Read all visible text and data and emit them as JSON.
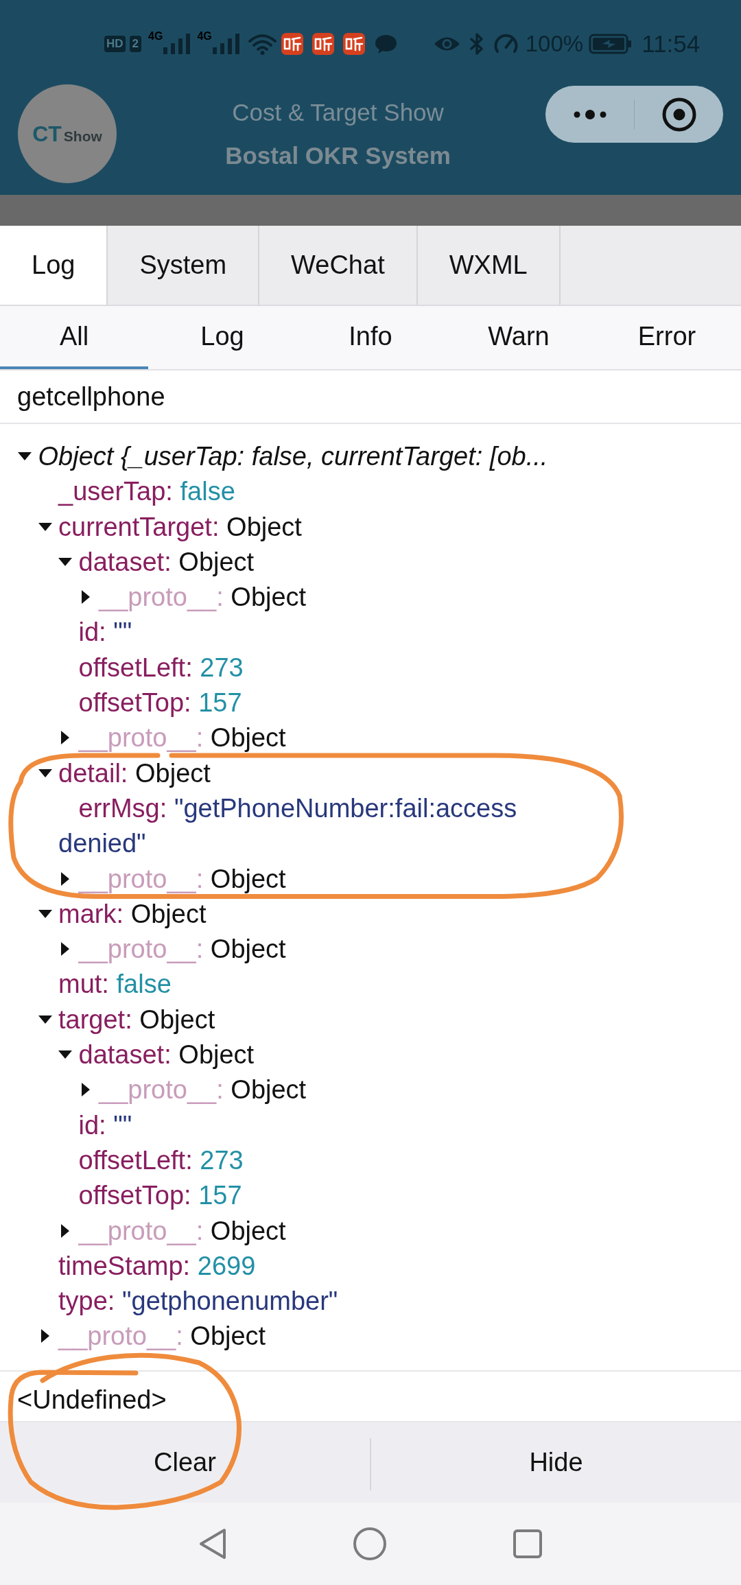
{
  "status_bar": {
    "hd_badge": "HD",
    "sim_badge": "2",
    "network_types": [
      "4G",
      "4G"
    ],
    "battery": "100%",
    "time": "11:54"
  },
  "header": {
    "logo": {
      "text": "CT",
      "subtext": "Show"
    },
    "title": "Cost & Target Show",
    "subtitle": "Bostal OKR System"
  },
  "tabs": [
    {
      "label": "Log",
      "selected": true
    },
    {
      "label": "System",
      "selected": false
    },
    {
      "label": "WeChat",
      "selected": false
    },
    {
      "label": "WXML",
      "selected": false
    }
  ],
  "filters": [
    {
      "label": "All",
      "selected": true
    },
    {
      "label": "Log",
      "selected": false
    },
    {
      "label": "Info",
      "selected": false
    },
    {
      "label": "Warn",
      "selected": false
    },
    {
      "label": "Error",
      "selected": false
    }
  ],
  "log_entries": [
    {
      "kind": "text",
      "text": "getcellphone"
    },
    {
      "kind": "object",
      "tree": [
        {
          "kind": "summary",
          "label": "Object {_userTap: false, currentTarget: [ob...",
          "expanded": true,
          "children": [
            {
              "kind": "boolean",
              "key": "_userTap:",
              "value": "false"
            },
            {
              "kind": "object",
              "key": "currentTarget:",
              "value": "Object",
              "expanded": true,
              "children": [
                {
                  "kind": "object",
                  "key": "dataset:",
                  "value": "Object",
                  "expanded": true,
                  "children": [
                    {
                      "kind": "proto",
                      "key": "__proto__:",
                      "value": "Object",
                      "expanded": false
                    }
                  ]
                },
                {
                  "kind": "string",
                  "key": "id:",
                  "value": "\"\""
                },
                {
                  "kind": "number",
                  "key": "offsetLeft:",
                  "value": "273"
                },
                {
                  "kind": "number",
                  "key": "offsetTop:",
                  "value": "157"
                },
                {
                  "kind": "proto",
                  "key": "__proto__:",
                  "value": "Object",
                  "expanded": false
                }
              ]
            },
            {
              "kind": "object",
              "key": "detail:",
              "value": "Object",
              "expanded": true,
              "children": [
                {
                  "kind": "string",
                  "key": "errMsg:",
                  "value": "\"getPhoneNumber:fail:access denied\""
                },
                {
                  "kind": "proto",
                  "key": "__proto__:",
                  "value": "Object",
                  "expanded": false
                }
              ]
            },
            {
              "kind": "object",
              "key": "mark:",
              "value": "Object",
              "expanded": true,
              "children": [
                {
                  "kind": "proto",
                  "key": "__proto__:",
                  "value": "Object",
                  "expanded": false
                }
              ]
            },
            {
              "kind": "boolean",
              "key": "mut:",
              "value": "false"
            },
            {
              "kind": "object",
              "key": "target:",
              "value": "Object",
              "expanded": true,
              "children": [
                {
                  "kind": "object",
                  "key": "dataset:",
                  "value": "Object",
                  "expanded": true,
                  "children": [
                    {
                      "kind": "proto",
                      "key": "__proto__:",
                      "value": "Object",
                      "expanded": false
                    }
                  ]
                },
                {
                  "kind": "string",
                  "key": "id:",
                  "value": "\"\""
                },
                {
                  "kind": "number",
                  "key": "offsetLeft:",
                  "value": "273"
                },
                {
                  "kind": "number",
                  "key": "offsetTop:",
                  "value": "157"
                },
                {
                  "kind": "proto",
                  "key": "__proto__:",
                  "value": "Object",
                  "expanded": false
                }
              ]
            },
            {
              "kind": "number",
              "key": "timeStamp:",
              "value": "2699"
            },
            {
              "kind": "string",
              "key": "type:",
              "value": "\"getphonenumber\""
            },
            {
              "kind": "proto",
              "key": "__proto__:",
              "value": "Object",
              "expanded": false
            }
          ]
        }
      ]
    },
    {
      "kind": "text",
      "text": "<Undefined>"
    }
  ],
  "footer_buttons": [
    "Clear",
    "Hide"
  ]
}
